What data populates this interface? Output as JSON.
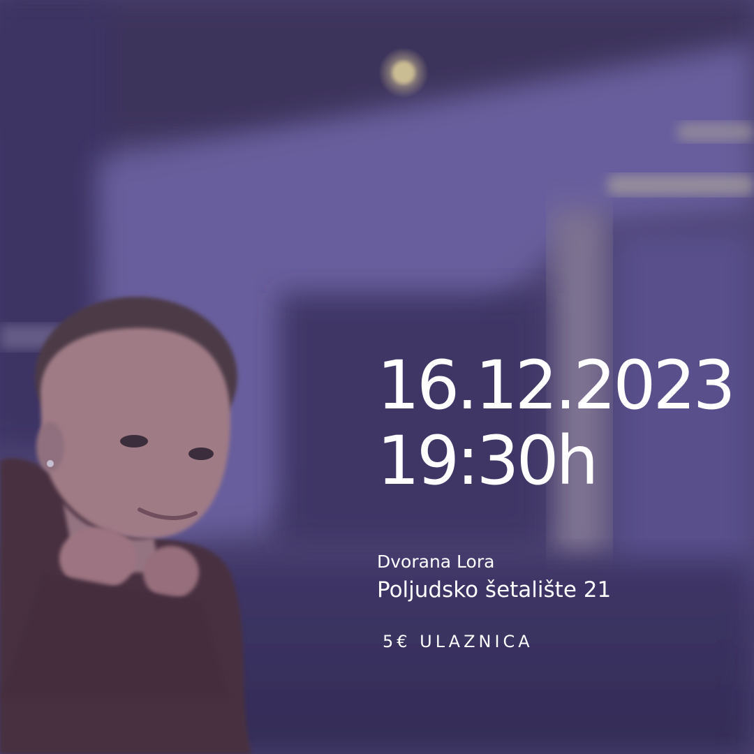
{
  "event": {
    "date": "16.12.2023",
    "time": "19:30h",
    "venue": "Dvorana Lora",
    "address": "Poljudsko šetalište 21",
    "ticket": "5€ ULAZNICA"
  },
  "colors": {
    "overlay": "#5a4f8c",
    "text": "#ffffff"
  }
}
